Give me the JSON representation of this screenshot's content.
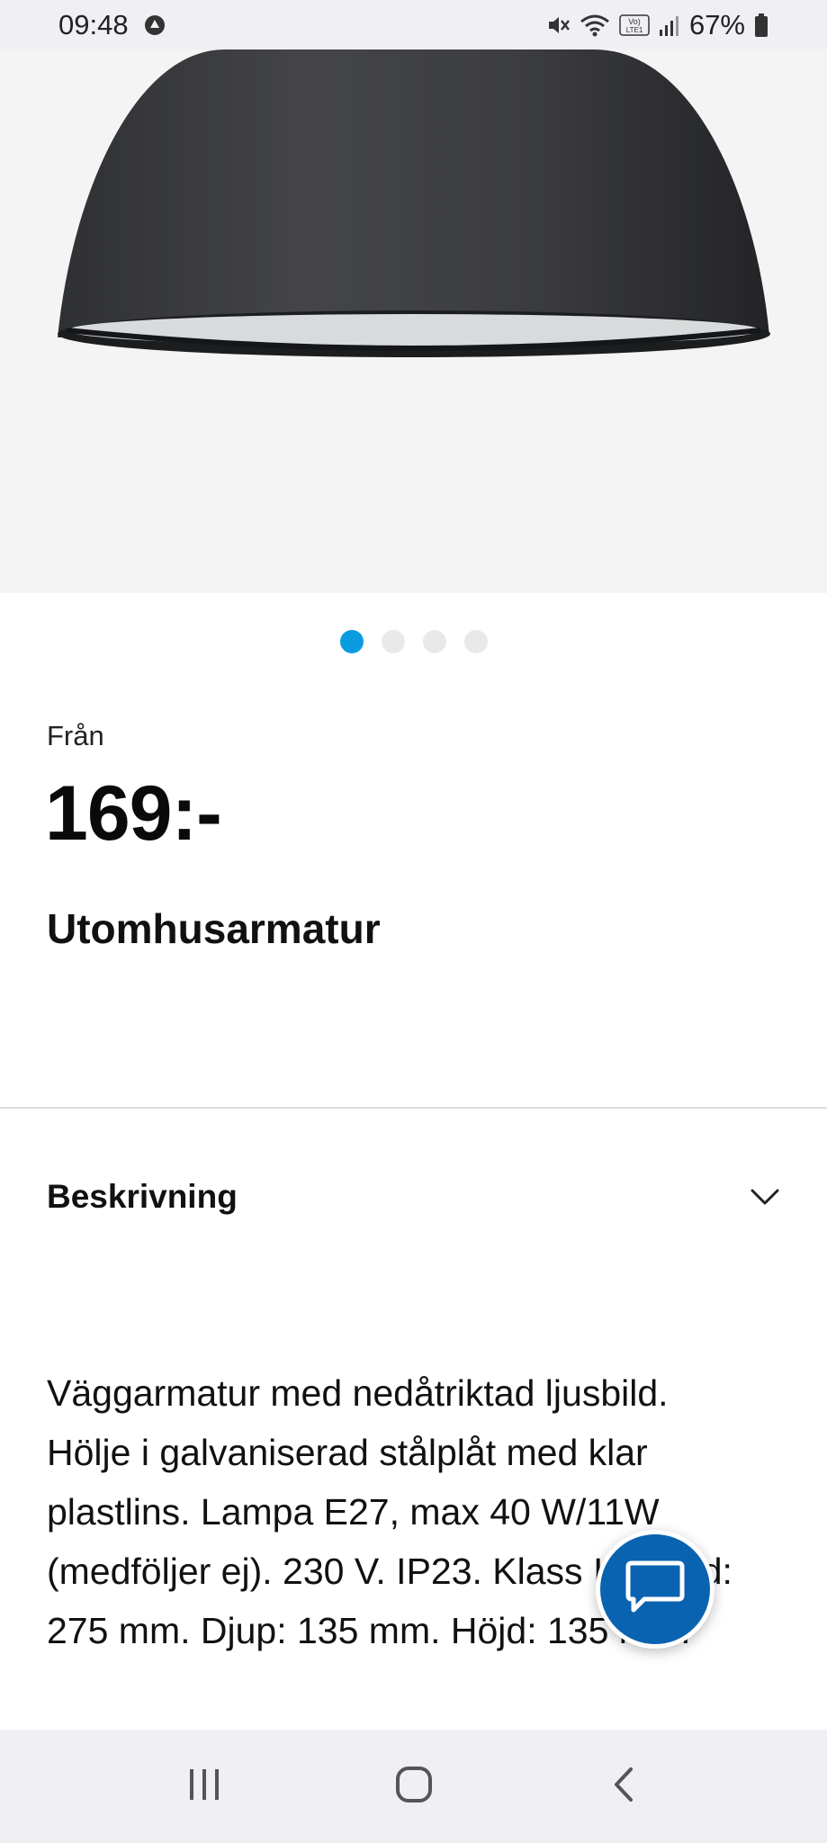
{
  "status_bar": {
    "time": "09:48",
    "battery": "67%",
    "network_label": "Vo) LTE1"
  },
  "product": {
    "image_alt_icon": "outdoor-lamp-image",
    "carousel": {
      "total": 4,
      "active_index": 0
    },
    "from_label": "Från",
    "price": "169:-",
    "title": "Utomhusarmatur"
  },
  "accordion": {
    "label": "Beskrivning",
    "expanded": true
  },
  "description": {
    "lines": [
      "Väggarmatur med nedåtriktad ljusbild.",
      "Hölje i galvaniserad stålplåt med klar",
      "plastlins. Lampa E27, max 40 W/11W",
      "(medföljer ej). 230 V. IP23. Klass I. Bredd:",
      "275 mm. Djup: 135 mm. Höjd: 135 mm."
    ]
  },
  "colors": {
    "accent_dot": "#0a9ce0",
    "chat_button": "#0a63b0",
    "status_bar_bg": "#efeff4"
  },
  "icons": {
    "chat": "chat-bubble-icon",
    "chevron": "chevron-down-icon",
    "nav_recent": "recent-apps-icon",
    "nav_home": "home-icon",
    "nav_back": "back-icon"
  }
}
